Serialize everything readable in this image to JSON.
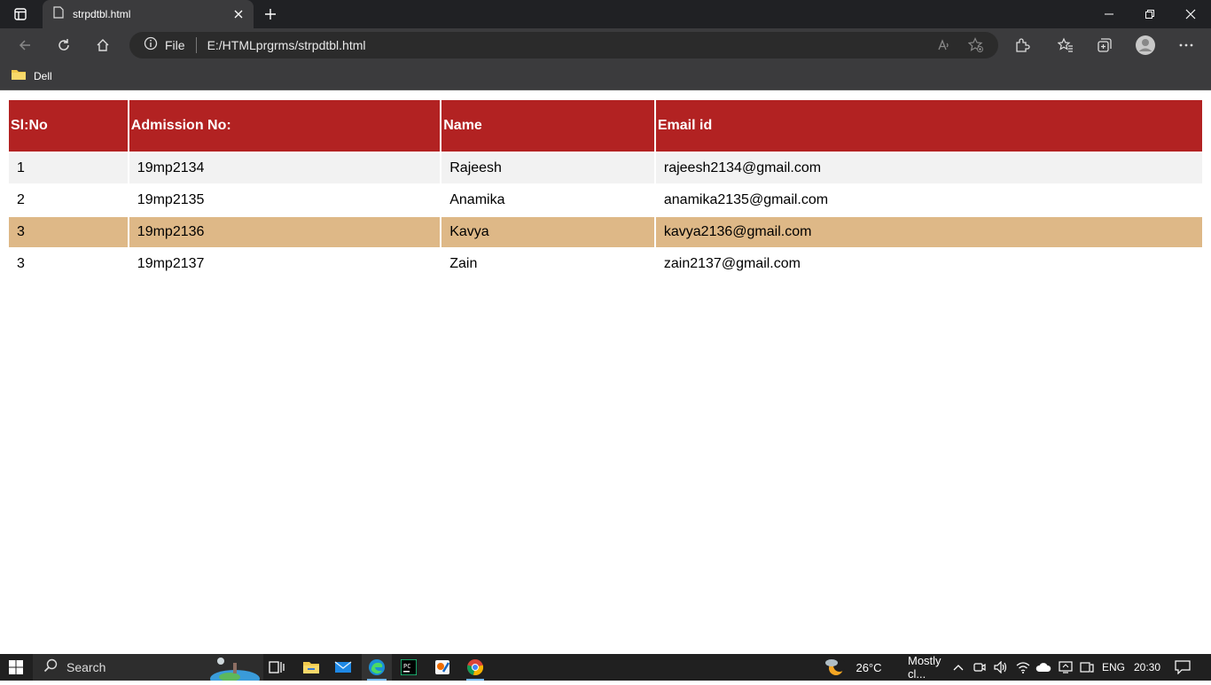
{
  "browser": {
    "tab_title": "strpdtbl.html",
    "file_label": "File",
    "url": "E:/HTMLprgrms/strpdtbl.html",
    "bookmark_label": "Dell"
  },
  "table": {
    "headers": [
      "Sl:No",
      "Admission No:",
      "Name",
      "Email id"
    ],
    "rows": [
      [
        "1",
        "19mp2134",
        "Rajeesh",
        "rajeesh2134@gmail.com"
      ],
      [
        "2",
        "19mp2135",
        "Anamika",
        "anamika2135@gmail.com"
      ],
      [
        "3",
        "19mp2136",
        "Kavya",
        "kavya2136@gmail.com"
      ],
      [
        "3",
        "19mp2137",
        "Zain",
        "zain2137@gmail.com"
      ]
    ],
    "colors": {
      "header_bg": "#b22222",
      "row_odd": "#f2f2f2",
      "row_highlight": "#deb887"
    }
  },
  "taskbar": {
    "search_label": "Search",
    "weather_temp": "26°C",
    "weather_text": "Mostly cl...",
    "language": "ENG",
    "time": "20:30"
  }
}
